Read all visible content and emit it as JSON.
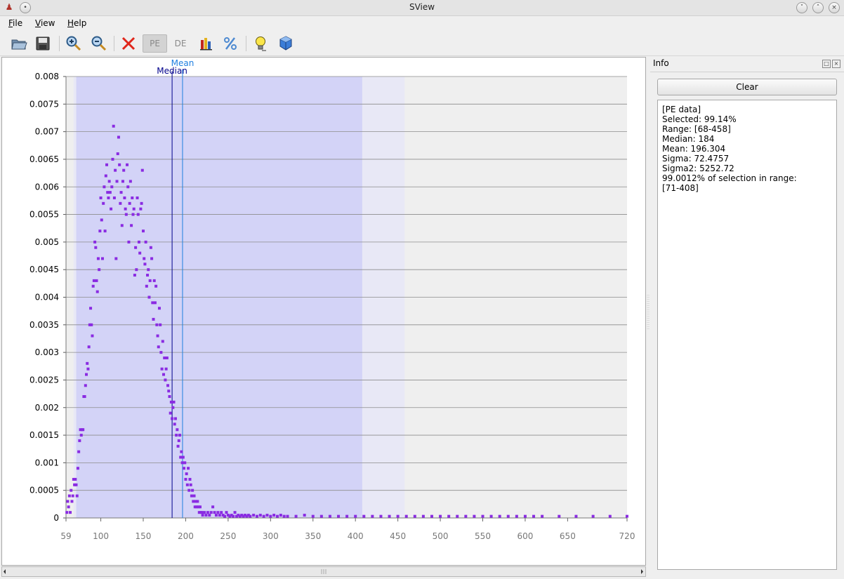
{
  "window": {
    "title": "SView"
  },
  "menu": [
    {
      "label": "File",
      "mnemonic": "F",
      "rest": "ile"
    },
    {
      "label": "View",
      "mnemonic": "V",
      "rest": "iew"
    },
    {
      "label": "Help",
      "mnemonic": "H",
      "rest": "elp"
    }
  ],
  "toolbar": {
    "open": "open-folder-icon",
    "save": "save-icon",
    "zoom_in": "zoom-in-icon",
    "zoom_out": "zoom-out-icon",
    "clear": "red-x-icon",
    "pe_label": "PE",
    "de_label": "DE",
    "color": "color-bars-icon",
    "percent": "percent-icon",
    "tip": "lightbulb-icon",
    "cube": "cube-icon"
  },
  "info": {
    "title": "Info",
    "clear_label": "Clear",
    "lines": [
      "[PE data]",
      "Selected: 99.14%",
      "Range: [68-458]",
      "Median: 184",
      "Mean: 196.304",
      "Sigma: 72.4757",
      "Sigma2: 5252.72",
      "99.0012% of selection in range:",
      "[71-408]"
    ]
  },
  "chart_data": {
    "type": "scatter",
    "xlim": [
      59,
      720
    ],
    "ylim": [
      0,
      0.008
    ],
    "xticks": [
      59,
      100,
      150,
      200,
      250,
      300,
      350,
      400,
      450,
      500,
      550,
      600,
      650,
      720
    ],
    "yticks": [
      "0",
      "0.0005",
      "0.001",
      "0.0015",
      "0.002",
      "0.0025",
      "0.003",
      "0.0035",
      "0.004",
      "0.0045",
      "0.005",
      "0.0055",
      "0.006",
      "0.0065",
      "0.007",
      "0.0075",
      "0.008"
    ],
    "selection_range": [
      68,
      458
    ],
    "in_range": [
      71,
      408
    ],
    "median": {
      "label": "Median",
      "value": 184
    },
    "mean": {
      "label": "Mean",
      "value": 196.304
    },
    "colors": {
      "points": "#8a2be2",
      "selection": "#e8e8f6",
      "in_range": "#d3d3f7",
      "median": "#00008b",
      "mean": "#1e7fe0",
      "plot_bg": "#efefef"
    },
    "points": [
      [
        60,
        0.0001
      ],
      [
        61,
        0.0003
      ],
      [
        62,
        0.0002
      ],
      [
        63,
        0.0004
      ],
      [
        64,
        0.0001
      ],
      [
        65,
        0.0005
      ],
      [
        66,
        0.0003
      ],
      [
        67,
        0.0004
      ],
      [
        68,
        0.0007
      ],
      [
        69,
        0.0006
      ],
      [
        70,
        0.0007
      ],
      [
        71,
        0.0006
      ],
      [
        72,
        0.0004
      ],
      [
        73,
        0.0009
      ],
      [
        74,
        0.0012
      ],
      [
        75,
        0.0014
      ],
      [
        76,
        0.0016
      ],
      [
        77,
        0.0015
      ],
      [
        78,
        0.0016
      ],
      [
        79,
        0.0016
      ],
      [
        80,
        0.0022
      ],
      [
        81,
        0.0022
      ],
      [
        82,
        0.0024
      ],
      [
        83,
        0.0026
      ],
      [
        84,
        0.0028
      ],
      [
        85,
        0.0027
      ],
      [
        86,
        0.0031
      ],
      [
        87,
        0.0035
      ],
      [
        88,
        0.0038
      ],
      [
        89,
        0.0035
      ],
      [
        90,
        0.0033
      ],
      [
        91,
        0.0042
      ],
      [
        92,
        0.0043
      ],
      [
        93,
        0.005
      ],
      [
        94,
        0.0049
      ],
      [
        95,
        0.0043
      ],
      [
        96,
        0.0041
      ],
      [
        97,
        0.0047
      ],
      [
        98,
        0.0045
      ],
      [
        99,
        0.0052
      ],
      [
        100,
        0.0058
      ],
      [
        101,
        0.0054
      ],
      [
        102,
        0.0047
      ],
      [
        103,
        0.0057
      ],
      [
        104,
        0.006
      ],
      [
        105,
        0.0052
      ],
      [
        106,
        0.0062
      ],
      [
        107,
        0.0064
      ],
      [
        108,
        0.0059
      ],
      [
        109,
        0.0058
      ],
      [
        110,
        0.0061
      ],
      [
        111,
        0.0059
      ],
      [
        112,
        0.0056
      ],
      [
        113,
        0.006
      ],
      [
        114,
        0.0065
      ],
      [
        115,
        0.0071
      ],
      [
        116,
        0.0058
      ],
      [
        117,
        0.0063
      ],
      [
        118,
        0.0047
      ],
      [
        119,
        0.0061
      ],
      [
        120,
        0.0066
      ],
      [
        121,
        0.0069
      ],
      [
        122,
        0.0064
      ],
      [
        123,
        0.0057
      ],
      [
        124,
        0.0059
      ],
      [
        125,
        0.0053
      ],
      [
        126,
        0.0061
      ],
      [
        127,
        0.0063
      ],
      [
        128,
        0.0058
      ],
      [
        129,
        0.0056
      ],
      [
        130,
        0.0055
      ],
      [
        131,
        0.0064
      ],
      [
        132,
        0.006
      ],
      [
        133,
        0.005
      ],
      [
        134,
        0.0057
      ],
      [
        135,
        0.0061
      ],
      [
        136,
        0.0053
      ],
      [
        137,
        0.0058
      ],
      [
        138,
        0.0055
      ],
      [
        139,
        0.0056
      ],
      [
        140,
        0.0044
      ],
      [
        141,
        0.0049
      ],
      [
        142,
        0.0045
      ],
      [
        143,
        0.0058
      ],
      [
        144,
        0.0055
      ],
      [
        145,
        0.005
      ],
      [
        146,
        0.0048
      ],
      [
        147,
        0.0056
      ],
      [
        148,
        0.0057
      ],
      [
        149,
        0.0063
      ],
      [
        150,
        0.0052
      ],
      [
        151,
        0.0047
      ],
      [
        152,
        0.0046
      ],
      [
        153,
        0.005
      ],
      [
        154,
        0.0042
      ],
      [
        155,
        0.0044
      ],
      [
        156,
        0.0045
      ],
      [
        157,
        0.004
      ],
      [
        158,
        0.0043
      ],
      [
        159,
        0.0049
      ],
      [
        160,
        0.0047
      ],
      [
        161,
        0.0039
      ],
      [
        162,
        0.0036
      ],
      [
        163,
        0.0043
      ],
      [
        164,
        0.0039
      ],
      [
        165,
        0.0042
      ],
      [
        166,
        0.0035
      ],
      [
        167,
        0.0033
      ],
      [
        168,
        0.0031
      ],
      [
        169,
        0.0038
      ],
      [
        170,
        0.0035
      ],
      [
        171,
        0.003
      ],
      [
        172,
        0.0027
      ],
      [
        173,
        0.0032
      ],
      [
        174,
        0.0026
      ],
      [
        175,
        0.0029
      ],
      [
        176,
        0.0025
      ],
      [
        177,
        0.0027
      ],
      [
        178,
        0.0029
      ],
      [
        179,
        0.0024
      ],
      [
        180,
        0.0023
      ],
      [
        181,
        0.0022
      ],
      [
        182,
        0.0019
      ],
      [
        183,
        0.0021
      ],
      [
        184,
        0.0018
      ],
      [
        185,
        0.002
      ],
      [
        186,
        0.0021
      ],
      [
        187,
        0.0017
      ],
      [
        188,
        0.0018
      ],
      [
        189,
        0.0015
      ],
      [
        190,
        0.0016
      ],
      [
        191,
        0.0013
      ],
      [
        192,
        0.0014
      ],
      [
        193,
        0.0015
      ],
      [
        194,
        0.0011
      ],
      [
        195,
        0.0012
      ],
      [
        196,
        0.001
      ],
      [
        197,
        0.0011
      ],
      [
        198,
        0.0009
      ],
      [
        199,
        0.001
      ],
      [
        200,
        0.0007
      ],
      [
        201,
        0.0008
      ],
      [
        202,
        0.0006
      ],
      [
        203,
        0.0009
      ],
      [
        204,
        0.0005
      ],
      [
        205,
        0.0007
      ],
      [
        206,
        0.0006
      ],
      [
        207,
        0.0004
      ],
      [
        208,
        0.0005
      ],
      [
        209,
        0.0003
      ],
      [
        210,
        0.0004
      ],
      [
        211,
        0.0002
      ],
      [
        212,
        0.0003
      ],
      [
        213,
        0.0002
      ],
      [
        214,
        0.0003
      ],
      [
        215,
        0.0002
      ],
      [
        216,
        0.0001
      ],
      [
        217,
        0.0002
      ],
      [
        218,
        0.0001
      ],
      [
        219,
        0.0001
      ],
      [
        220,
        5e-05
      ],
      [
        222,
        0.0001
      ],
      [
        224,
        5e-05
      ],
      [
        226,
        0.0001
      ],
      [
        228,
        5e-05
      ],
      [
        230,
        0.0001
      ],
      [
        232,
        0.0002
      ],
      [
        234,
        0.0001
      ],
      [
        236,
        5e-05
      ],
      [
        238,
        0.0001
      ],
      [
        240,
        5e-05
      ],
      [
        242,
        0.0001
      ],
      [
        244,
        5e-05
      ],
      [
        246,
        3e-05
      ],
      [
        248,
        0.0001
      ],
      [
        250,
        5e-05
      ],
      [
        252,
        3e-05
      ],
      [
        254,
        5e-05
      ],
      [
        256,
        3e-05
      ],
      [
        258,
        0.0001
      ],
      [
        260,
        3e-05
      ],
      [
        262,
        5e-05
      ],
      [
        264,
        3e-05
      ],
      [
        266,
        5e-05
      ],
      [
        268,
        3e-05
      ],
      [
        270,
        5e-05
      ],
      [
        272,
        3e-05
      ],
      [
        274,
        5e-05
      ],
      [
        276,
        3e-05
      ],
      [
        280,
        5e-05
      ],
      [
        284,
        3e-05
      ],
      [
        288,
        5e-05
      ],
      [
        292,
        3e-05
      ],
      [
        296,
        5e-05
      ],
      [
        300,
        3e-05
      ],
      [
        304,
        5e-05
      ],
      [
        308,
        3e-05
      ],
      [
        312,
        5e-05
      ],
      [
        316,
        3e-05
      ],
      [
        320,
        3e-05
      ],
      [
        330,
        3e-05
      ],
      [
        340,
        5e-05
      ],
      [
        350,
        3e-05
      ],
      [
        360,
        3e-05
      ],
      [
        370,
        3e-05
      ],
      [
        380,
        3e-05
      ],
      [
        390,
        3e-05
      ],
      [
        400,
        3e-05
      ],
      [
        410,
        3e-05
      ],
      [
        420,
        3e-05
      ],
      [
        430,
        3e-05
      ],
      [
        440,
        3e-05
      ],
      [
        450,
        3e-05
      ],
      [
        460,
        3e-05
      ],
      [
        470,
        3e-05
      ],
      [
        480,
        3e-05
      ],
      [
        490,
        3e-05
      ],
      [
        500,
        3e-05
      ],
      [
        510,
        3e-05
      ],
      [
        520,
        3e-05
      ],
      [
        530,
        3e-05
      ],
      [
        540,
        3e-05
      ],
      [
        550,
        3e-05
      ],
      [
        560,
        3e-05
      ],
      [
        570,
        3e-05
      ],
      [
        580,
        3e-05
      ],
      [
        590,
        3e-05
      ],
      [
        600,
        3e-05
      ],
      [
        610,
        3e-05
      ],
      [
        620,
        3e-05
      ],
      [
        640,
        3e-05
      ],
      [
        660,
        3e-05
      ],
      [
        680,
        3e-05
      ],
      [
        700,
        3e-05
      ],
      [
        720,
        3e-05
      ]
    ]
  }
}
